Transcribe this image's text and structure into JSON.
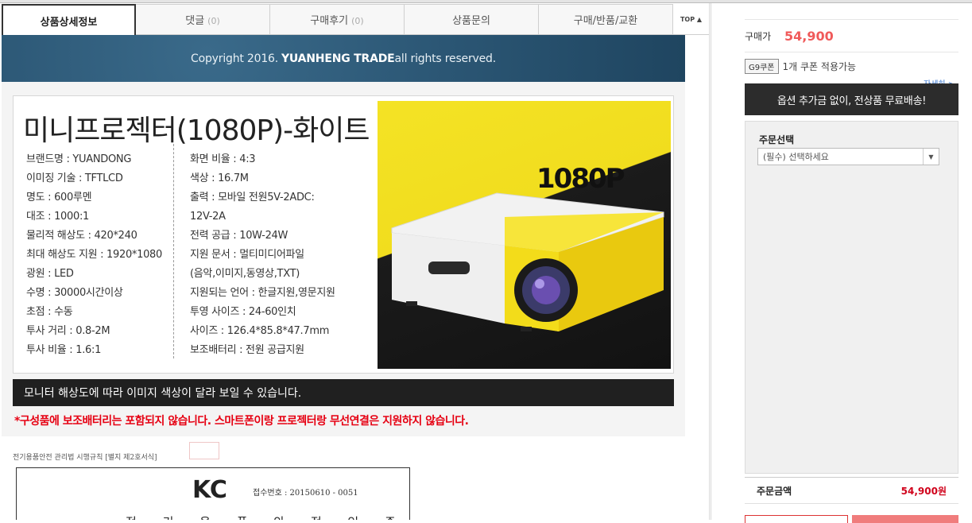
{
  "tabs": [
    {
      "label": "상품상세정보",
      "count": ""
    },
    {
      "label": "댓글",
      "count": "(0)"
    },
    {
      "label": "구매후기",
      "count": "(0)"
    },
    {
      "label": "상품문의",
      "count": ""
    },
    {
      "label": "구매/반품/교환",
      "count": ""
    }
  ],
  "top_label": "TOP ▲",
  "banner": {
    "prefix": "Copyright 2016.",
    "brand": "YUANHENG TRADE",
    "suffix": " all rights reserved."
  },
  "product": {
    "title": "미니프로젝터(1080P)-화이트",
    "resolution_badge": "1080P",
    "specs_left": [
      "브랜드명 : YUANDONG",
      "이미징 기술 : TFTLCD",
      "명도 : 600루멘",
      "대조 : 1000:1",
      "물리적 해상도 : 420*240",
      "최대 해상도 지원 : 1920*1080",
      "광원 : LED",
      "수명 : 30000시간이상",
      "초점 : 수동",
      "투사 거리 : 0.8-2M",
      "투사 비율 : 1.6:1"
    ],
    "specs_right": [
      "화면 비율 : 4:3",
      "색상 : 16.7M",
      "출력 : 모바일 전원5V-2ADC:",
      "12V-2A",
      "전력 공급 : 10W-24W",
      "지원 문서 : 멀티미디어파일",
      "(음악,이미지,동영상,TXT)",
      "지원되는 언어 : 한글지원,영문지원",
      "투영 사이즈 : 24-60인치",
      "사이즈 : 126.4*85.8*47.7mm",
      "보조배터리 : 전원 공급지원"
    ]
  },
  "notice": "모니터 해상도에 따라 이미지 색상이 달라 보일 수 있습니다.",
  "warning": "*구성품에 보조배터리는 포함되지 않습니다. 스마트폰이랑 프로젝터랑 무선연결은 지원하지 않습니다.",
  "cert": {
    "header": "전기용품안전 관리법 시행규칙 [별지 제2호서식]",
    "logo": "KC",
    "reg_no": "접수번호 : 20150610 - 0051",
    "title": "전 기 용 품 안 전 인 증 서"
  },
  "sidebar": {
    "price_label": "구매가",
    "price": "54,900",
    "coupon_badge": "G9쿠폰",
    "coupon_text": "1개 쿠폰 적용가능",
    "more": "자세히 >",
    "free_shipping": "옵션 추가금 없이, 전상품 무료배송!",
    "order_label": "주문선택",
    "select_placeholder": "(필수) 선택하세요",
    "total_label": "주문금액",
    "total_value": "54,900원"
  },
  "colors": {
    "accent_price": "#f05a5a",
    "warning": "#e60012",
    "total": "#d0021b"
  }
}
